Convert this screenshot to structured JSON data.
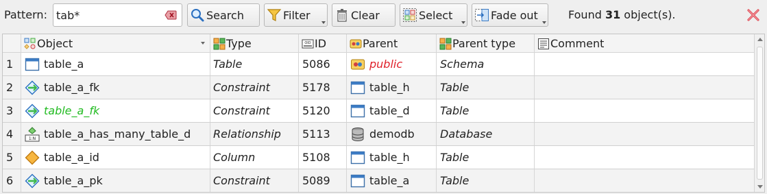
{
  "toolbar": {
    "pattern_label": "Pattern:",
    "pattern_value": "tab*",
    "search_label": "Search",
    "filter_label": "Filter",
    "clear_label": "Clear",
    "select_label": "Select",
    "fadeout_label": "Fade out",
    "found_prefix": "Found ",
    "found_count": "31",
    "found_suffix": " object(s)."
  },
  "colors": {
    "green_text": "#22bb22",
    "red_text": "#e0202a",
    "close_red": "#e0505a"
  },
  "table": {
    "headers": {
      "object": "Object",
      "type": "Type",
      "id": "ID",
      "parent": "Parent",
      "parent_type": "Parent type",
      "comment": "Comment"
    },
    "rows": [
      {
        "num": "1",
        "object": "table_a",
        "object_icon": "table-icon",
        "type": "Table",
        "id": "5086",
        "parent": "public",
        "parent_icon": "schema-icon",
        "parent_type": "Schema",
        "comment": ""
      },
      {
        "num": "2",
        "object": "table_a_fk",
        "object_icon": "constraint-icon",
        "type": "Constraint",
        "id": "5178",
        "parent": "table_h",
        "parent_icon": "table-icon",
        "parent_type": "Table",
        "comment": ""
      },
      {
        "num": "3",
        "object": "table_a_fk",
        "object_icon": "constraint-icon",
        "type": "Constraint",
        "id": "5120",
        "parent": "table_d",
        "parent_icon": "table-icon",
        "parent_type": "Table",
        "comment": ""
      },
      {
        "num": "4",
        "object": "table_a_has_many_table_d",
        "object_icon": "relationship-icon",
        "type": "Relationship",
        "id": "5113",
        "parent": "demodb",
        "parent_icon": "database-icon",
        "parent_type": "Database",
        "comment": ""
      },
      {
        "num": "5",
        "object": "table_a_id",
        "object_icon": "column-icon",
        "type": "Column",
        "id": "5108",
        "parent": "table_h",
        "parent_icon": "table-icon",
        "parent_type": "Table",
        "comment": ""
      },
      {
        "num": "6",
        "object": "table_a_pk",
        "object_icon": "constraint-icon",
        "type": "Constraint",
        "id": "5089",
        "parent": "table_a",
        "parent_icon": "table-icon",
        "parent_type": "Table",
        "comment": ""
      }
    ]
  }
}
